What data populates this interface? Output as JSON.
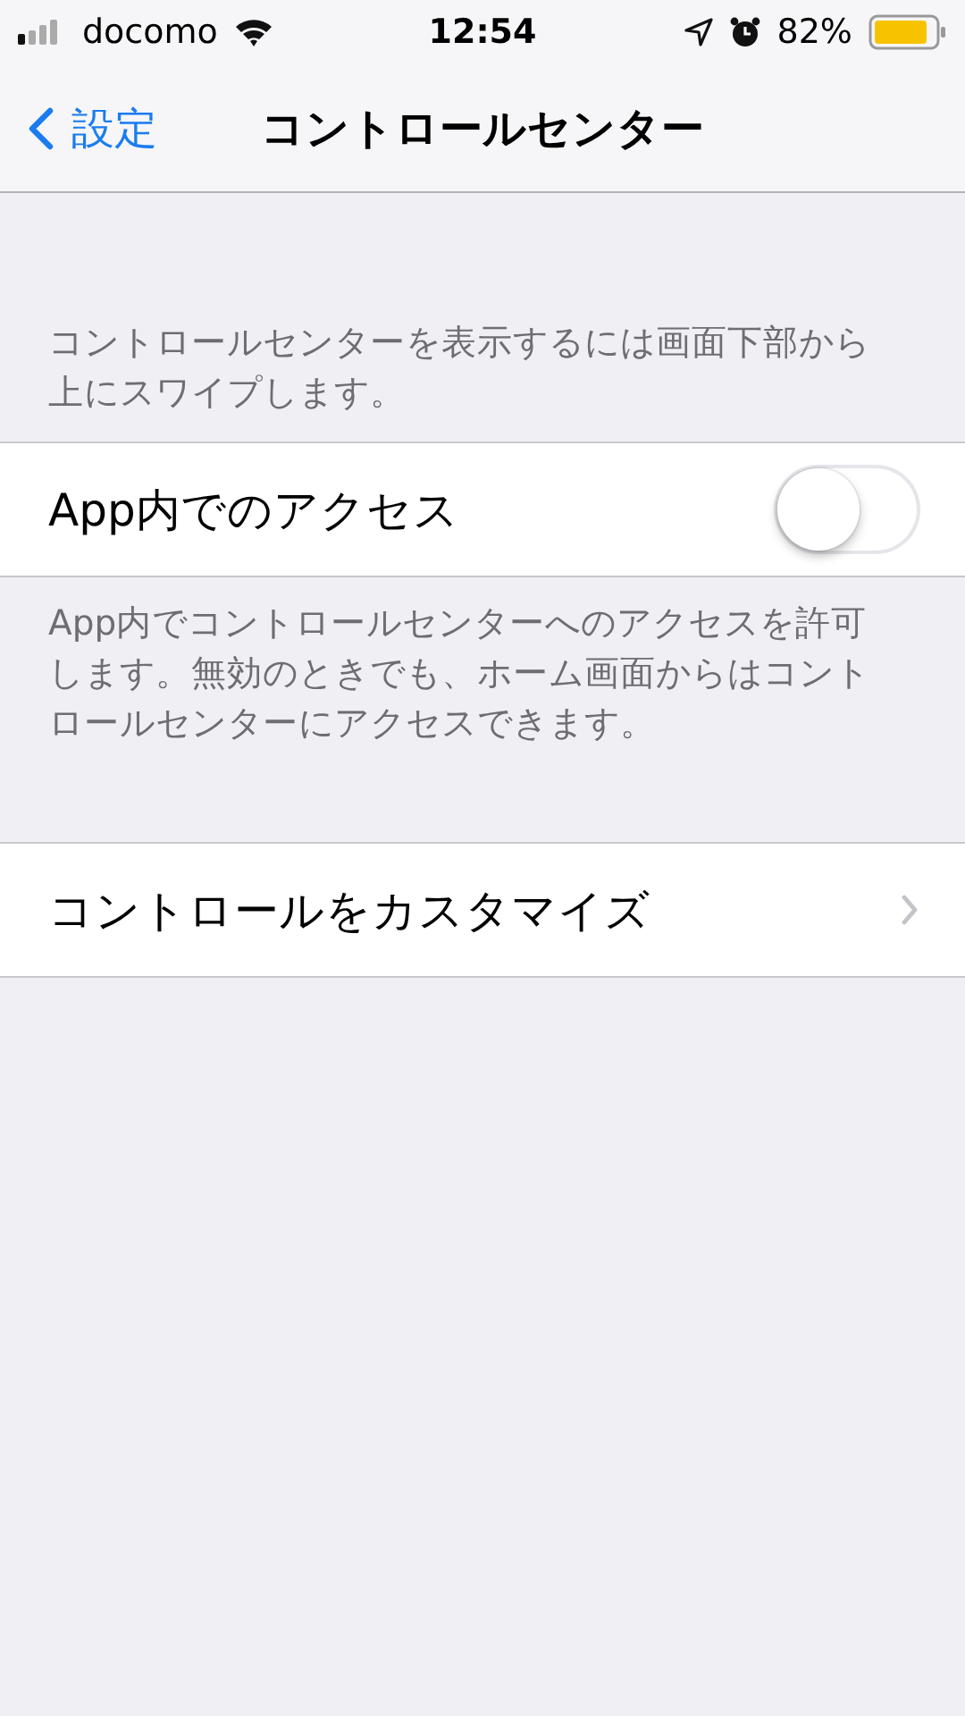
{
  "status_bar": {
    "carrier": "docomo",
    "time": "12:54",
    "battery": "82%"
  },
  "nav": {
    "back": "設定",
    "title": "コントロールセンター"
  },
  "sections": [
    {
      "header": "コントロールセンターを表示するには画面下部から上にスワイプします。",
      "rows": [
        {
          "kind": "toggle",
          "label": "App内でのアクセス",
          "on": false
        }
      ],
      "footer": "App内でコントロールセンターへのアクセスを許可します。無効のときでも、ホーム画面からはコントロールセンターにアクセスできます。"
    },
    {
      "rows": [
        {
          "kind": "link",
          "label": "コントロールをカスタマイズ"
        }
      ]
    }
  ]
}
